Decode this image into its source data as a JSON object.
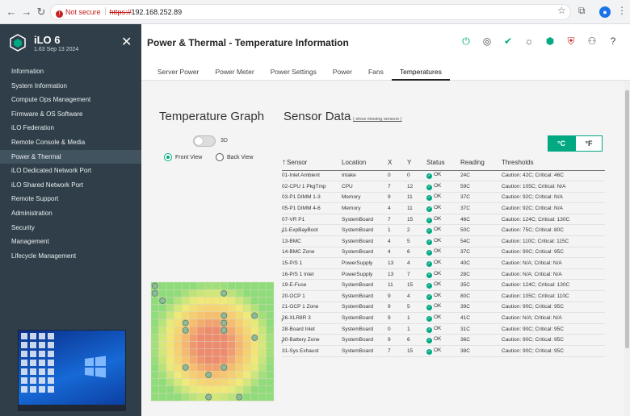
{
  "browser": {
    "not_secure": "Not secure",
    "scheme": "https://",
    "host": "192.168.252.89"
  },
  "sidebar": {
    "title": "iLO 6",
    "subtitle": "1.63 Sep 13 2024",
    "items": [
      {
        "label": "Information"
      },
      {
        "label": "System Information"
      },
      {
        "label": "Compute Ops Management"
      },
      {
        "label": "Firmware & OS Software"
      },
      {
        "label": "iLO Federation"
      },
      {
        "label": "Remote Console & Media"
      },
      {
        "label": "Power & Thermal"
      },
      {
        "label": "iLO Dedicated Network Port"
      },
      {
        "label": "iLO Shared Network Port"
      },
      {
        "label": "Remote Support"
      },
      {
        "label": "Administration"
      },
      {
        "label": "Security"
      },
      {
        "label": "Management"
      },
      {
        "label": "Lifecycle Management"
      }
    ],
    "active_index": 6
  },
  "header": {
    "title": "Power & Thermal - Temperature Information"
  },
  "tabs": [
    {
      "label": "Server Power"
    },
    {
      "label": "Power Meter"
    },
    {
      "label": "Power Settings"
    },
    {
      "label": "Power"
    },
    {
      "label": "Fans"
    },
    {
      "label": "Temperatures"
    }
  ],
  "active_tab": 5,
  "graph": {
    "title": "Temperature Graph",
    "toggle_label": "3D",
    "front_view": "Front View",
    "back_view": "Back View"
  },
  "sensor_data": {
    "title": "Sensor Data",
    "show_missing": "( show missing sensors )",
    "unit_c": "°C",
    "unit_f": "°F",
    "columns": {
      "sensor": "Sensor",
      "location": "Location",
      "x": "X",
      "y": "Y",
      "status": "Status",
      "reading": "Reading",
      "thresholds": "Thresholds"
    },
    "rows": [
      {
        "sensor": "01-Inlet Ambient",
        "location": "Intake",
        "x": "0",
        "y": "0",
        "status": "OK",
        "reading": "24C",
        "thresholds": "Caution: 42C; Critical: 46C"
      },
      {
        "sensor": "02-CPU 1 PkgTmp",
        "location": "CPU",
        "x": "7",
        "y": "12",
        "status": "OK",
        "reading": "59C",
        "thresholds": "Caution: 105C; Critical: N/A"
      },
      {
        "sensor": "03-P1 DIMM 1-3",
        "location": "Memory",
        "x": "9",
        "y": "11",
        "status": "OK",
        "reading": "37C",
        "thresholds": "Caution: 92C; Critical: N/A"
      },
      {
        "sensor": "05-P1 DIMM 4-6",
        "location": "Memory",
        "x": "4",
        "y": "11",
        "status": "OK",
        "reading": "37C",
        "thresholds": "Caution: 92C; Critical: N/A"
      },
      {
        "sensor": "07-VR P1",
        "location": "SystemBoard",
        "x": "7",
        "y": "15",
        "status": "OK",
        "reading": "46C",
        "thresholds": "Caution: 124C; Critical: 130C"
      },
      {
        "sensor": "11-ExpBayBoot",
        "location": "SystemBoard",
        "x": "1",
        "y": "2",
        "status": "OK",
        "reading": "50C",
        "thresholds": "Caution: 75C; Critical: 80C"
      },
      {
        "sensor": "13-BMC",
        "location": "SystemBoard",
        "x": "4",
        "y": "5",
        "status": "OK",
        "reading": "54C",
        "thresholds": "Caution: 110C; Critical: 115C"
      },
      {
        "sensor": "14-BMC Zone",
        "location": "SystemBoard",
        "x": "4",
        "y": "6",
        "status": "OK",
        "reading": "37C",
        "thresholds": "Caution: 90C; Critical: 95C"
      },
      {
        "sensor": "15-P/S 1",
        "location": "PowerSupply",
        "x": "13",
        "y": "4",
        "status": "OK",
        "reading": "40C",
        "thresholds": "Caution: N/A; Critical: N/A"
      },
      {
        "sensor": "16-P/S 1 Inlet",
        "location": "PowerSupply",
        "x": "13",
        "y": "7",
        "status": "OK",
        "reading": "28C",
        "thresholds": "Caution: N/A; Critical: N/A"
      },
      {
        "sensor": "19-E-Fuse",
        "location": "SystemBoard",
        "x": "11",
        "y": "15",
        "status": "OK",
        "reading": "35C",
        "thresholds": "Caution: 124C; Critical: 130C"
      },
      {
        "sensor": "20-OCP 1",
        "location": "SystemBoard",
        "x": "9",
        "y": "4",
        "status": "OK",
        "reading": "80C",
        "thresholds": "Caution: 105C; Critical: 110C"
      },
      {
        "sensor": "21-OCP 1 Zone",
        "location": "SystemBoard",
        "x": "9",
        "y": "5",
        "status": "OK",
        "reading": "39C",
        "thresholds": "Caution: 90C; Critical: 95C"
      },
      {
        "sensor": "26-XLR8R 3",
        "location": "SystemBoard",
        "x": "9",
        "y": "1",
        "status": "OK",
        "reading": "41C",
        "thresholds": "Caution: N/A; Critical: N/A"
      },
      {
        "sensor": "28-Board Inlet",
        "location": "SystemBoard",
        "x": "0",
        "y": "1",
        "status": "OK",
        "reading": "31C",
        "thresholds": "Caution: 90C; Critical: 95C"
      },
      {
        "sensor": "30-Battery Zone",
        "location": "SystemBoard",
        "x": "9",
        "y": "6",
        "status": "OK",
        "reading": "36C",
        "thresholds": "Caution: 90C; Critical: 95C"
      },
      {
        "sensor": "31-Sys Exhaust",
        "location": "SystemBoard",
        "x": "7",
        "y": "15",
        "status": "OK",
        "reading": "38C",
        "thresholds": "Caution: 90C; Critical: 95C"
      }
    ]
  },
  "colors": {
    "accent": "#01a982",
    "sidebar_bg": "#2f3e48",
    "hot": "#ee8a6e",
    "cool": "#8fdc7a"
  }
}
